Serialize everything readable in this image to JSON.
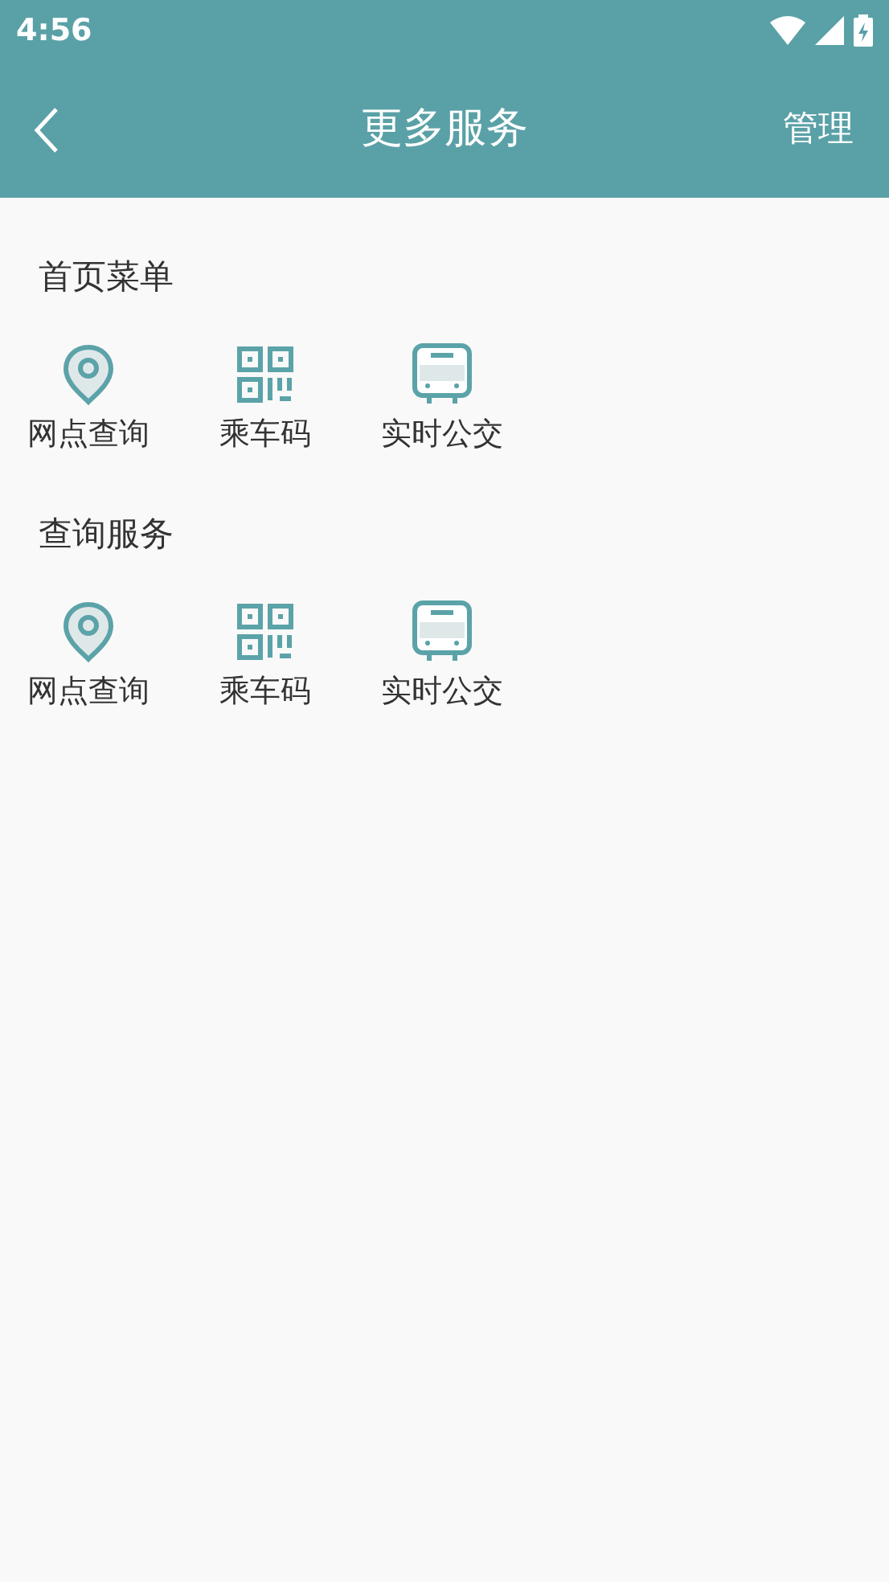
{
  "status_bar": {
    "time": "4:56"
  },
  "header": {
    "title": "更多服务",
    "action": "管理"
  },
  "sections": [
    {
      "title": "首页菜单",
      "items": [
        {
          "label": "网点查询",
          "kind": "pin"
        },
        {
          "label": "乘车码",
          "kind": "qr"
        },
        {
          "label": "实时公交",
          "kind": "bus"
        }
      ]
    },
    {
      "title": "查询服务",
      "items": [
        {
          "label": "网点查询",
          "kind": "pin"
        },
        {
          "label": "乘车码",
          "kind": "qr"
        },
        {
          "label": "实时公交",
          "kind": "bus"
        }
      ]
    }
  ]
}
